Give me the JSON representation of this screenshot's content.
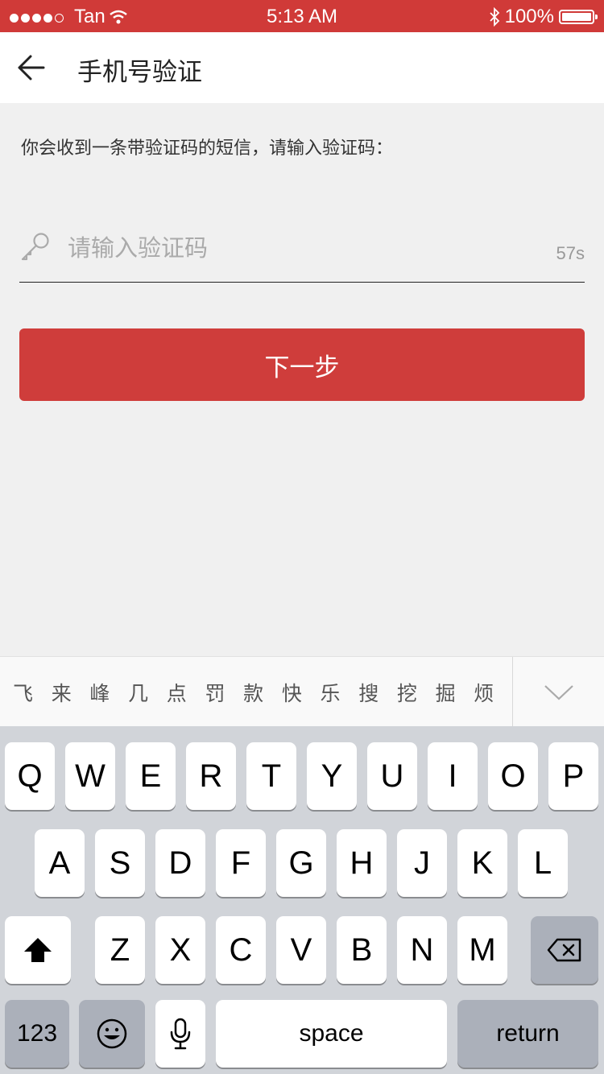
{
  "status_bar": {
    "carrier": "Tan",
    "time": "5:13 AM",
    "battery": "100%",
    "signal_bars_filled": 4,
    "signal_bars_total": 5
  },
  "nav": {
    "back_icon": "arrow-left-icon",
    "title": "手机号验证"
  },
  "content": {
    "hint": "你会收到一条带验证码的短信，请输入验证码：",
    "code_input": {
      "placeholder": "请输入验证码",
      "value": "",
      "icon": "key-icon"
    },
    "countdown": "57s",
    "next_button": "下一步"
  },
  "candidates": {
    "items": [
      "飞",
      "来",
      "峰",
      "几",
      "点",
      "罚",
      "款",
      "快",
      "乐",
      "搜",
      "挖",
      "掘",
      "烦"
    ],
    "collapse_icon": "chevron-down-icon"
  },
  "keyboard": {
    "row1": [
      "Q",
      "W",
      "E",
      "R",
      "T",
      "Y",
      "U",
      "I",
      "O",
      "P"
    ],
    "row2": [
      "A",
      "S",
      "D",
      "F",
      "G",
      "H",
      "J",
      "K",
      "L"
    ],
    "row3": [
      "Z",
      "X",
      "C",
      "V",
      "B",
      "N",
      "M"
    ],
    "numbers_label": "123",
    "space_label": "space",
    "return_label": "return",
    "shift_icon": "shift-icon",
    "delete_icon": "backspace-icon",
    "emoji_icon": "emoji-icon",
    "mic_icon": "microphone-icon"
  },
  "colors": {
    "brand_red": "#cf3d3b",
    "background": "#f0f0f0",
    "keyboard_bg": "#d1d4d9"
  }
}
